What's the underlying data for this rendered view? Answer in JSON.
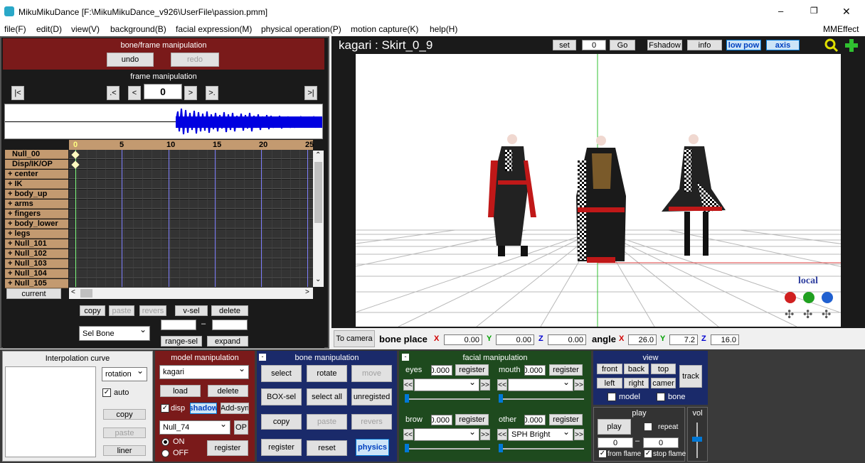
{
  "window": {
    "title": "MikuMikuDance [F:\\MikuMikuDance_v926\\UserFile\\passion.pmm]",
    "minimize": "–",
    "maximize": "❐",
    "close": "✕"
  },
  "menu": {
    "items": [
      "file(F)",
      "edit(D)",
      "view(V)",
      "background(B)",
      "facial expression(M)",
      "physical operation(P)",
      "motion capture(K)",
      "help(H)"
    ],
    "right": "MMEffect"
  },
  "bone_frame": {
    "title": "bone/frame manipulation",
    "undo": "undo",
    "redo": "redo"
  },
  "frame": {
    "title": "frame manipulation",
    "first": "|<",
    "prev_key": ".<",
    "prev": "<",
    "value": "0",
    "next": ">",
    "next_key": ">.",
    "last": ">|"
  },
  "timeline": {
    "ticks": [
      "0",
      "5",
      "10",
      "15",
      "20",
      "25"
    ],
    "tracks": [
      "Null_00",
      "Disp/IK/OP",
      "+ center",
      "+ IK",
      "+ body_up",
      "+ arms",
      "+ fingers",
      "+ body_lower",
      "+ legs",
      "+ Null_101",
      "+ Null_102",
      "+ Null_103",
      "+ Null_104",
      "+ Null_105"
    ],
    "current": "current"
  },
  "edit": {
    "copy": "copy",
    "paste": "paste",
    "revers": "revers",
    "vsel": "v-sel",
    "delete": "delete",
    "selbone": "Sel Bone",
    "range_from": "",
    "dash": "–",
    "range_to": "",
    "range_sel": "range-sel",
    "expand": "expand"
  },
  "viewport": {
    "model_bone": "kagari : Skirt_0_9",
    "set": "set",
    "frame": "0",
    "go": "Go",
    "fshadow": "Fshadow",
    "info": "info",
    "lowpow": "low pow",
    "axis": "axis",
    "local": "local"
  },
  "place": {
    "to_camera": "To camera",
    "bone_place": "bone place",
    "x": "0.00",
    "y": "0.00",
    "z": "0.00",
    "angle": "angle",
    "ax": "26.0",
    "ay": "7.2",
    "az": "16.0",
    "X": "X",
    "Y": "Y",
    "Z": "Z"
  },
  "interp": {
    "title": "Interpolation curve",
    "mode": "rotation",
    "auto": "auto",
    "copy": "copy",
    "paste": "paste",
    "liner": "liner"
  },
  "model": {
    "title": "model manipulation",
    "model": "kagari",
    "load": "load",
    "delete": "delete",
    "disp": "disp",
    "shadow": "shadow",
    "addsync": "Add-syn",
    "bone": "Null_74",
    "op": "OP",
    "on": "ON",
    "off": "OFF",
    "register": "register"
  },
  "bone": {
    "title": "bone manipulation",
    "select": "select",
    "rotate": "rotate",
    "move": "move",
    "boxsel": "BOX-sel",
    "selectall": "select all",
    "unregisted": "unregisted",
    "copy": "copy",
    "paste": "paste",
    "revers": "revers",
    "register": "register",
    "reset": "reset",
    "physics": "physics"
  },
  "facial": {
    "title": "facial manipulation",
    "eyes": "eyes",
    "eyes_val": "0.000",
    "mouth": "mouth",
    "mouth_val": "0.000",
    "brow": "brow",
    "brow_val": "0.000",
    "other": "other",
    "other_val": "0.000",
    "register": "register",
    "other_sel": "SPH Bright",
    "prev": "<<",
    "next": ">>"
  },
  "view": {
    "title": "view",
    "front": "front",
    "back": "back",
    "top": "top",
    "left": "left",
    "right": "right",
    "camera": "camer",
    "track": "track",
    "model": "model",
    "bone": "bone"
  },
  "play": {
    "title": "play",
    "play": "play",
    "repeat": "repeat",
    "from": "0",
    "dash": "–",
    "to": "0",
    "from_flame": "from flame",
    "stop_flame": "stop flame"
  },
  "vol": {
    "title": "vol"
  }
}
